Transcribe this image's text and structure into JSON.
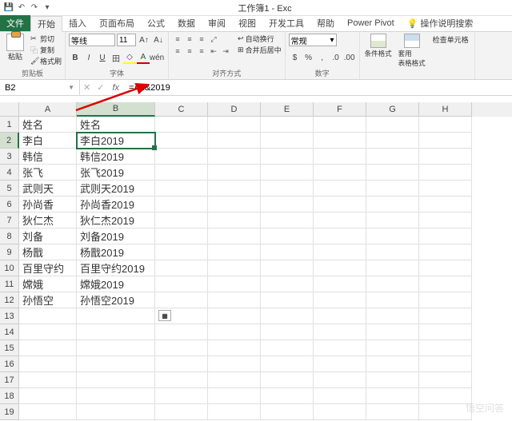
{
  "titlebar": {
    "title": "工作簿1 - Exc"
  },
  "tabs": {
    "file": "文件",
    "home": "开始",
    "insert": "插入",
    "layout": "页面布局",
    "formulas": "公式",
    "data": "数据",
    "review": "审阅",
    "view": "视图",
    "dev": "开发工具",
    "help": "帮助",
    "powerpivot": "Power Pivot",
    "tellme": "操作说明搜索"
  },
  "ribbon": {
    "clipboard": {
      "paste": "粘贴",
      "cut": "剪切",
      "copy": "复制",
      "format_painter": "格式刷",
      "label": "剪贴板"
    },
    "font": {
      "name": "等线",
      "size": "11",
      "label": "字体"
    },
    "alignment": {
      "wrap": "自动换行",
      "merge": "合并后居中",
      "label": "对齐方式"
    },
    "number": {
      "format": "常规",
      "label": "数字"
    },
    "styles": {
      "cond": "条件格式",
      "table": "套用\n表格格式",
      "cell_style": "检查单元格"
    }
  },
  "namebox": "B2",
  "formula": "=A2&2019",
  "columns": [
    "A",
    "B",
    "C",
    "D",
    "E",
    "F",
    "G",
    "H"
  ],
  "rows": [
    {
      "n": 1,
      "A": "姓名",
      "B": "姓名"
    },
    {
      "n": 2,
      "A": "李白",
      "B": "李白2019"
    },
    {
      "n": 3,
      "A": "韩信",
      "B": "韩信2019"
    },
    {
      "n": 4,
      "A": "张飞",
      "B": "张飞2019"
    },
    {
      "n": 5,
      "A": "武则天",
      "B": "武则天2019"
    },
    {
      "n": 6,
      "A": "孙尚香",
      "B": "孙尚香2019"
    },
    {
      "n": 7,
      "A": "狄仁杰",
      "B": "狄仁杰2019"
    },
    {
      "n": 8,
      "A": "刘备",
      "B": "刘备2019"
    },
    {
      "n": 9,
      "A": "杨戬",
      "B": "杨戬2019"
    },
    {
      "n": 10,
      "A": "百里守约",
      "B": "百里守约2019"
    },
    {
      "n": 11,
      "A": "嫦娥",
      "B": "嫦娥2019"
    },
    {
      "n": 12,
      "A": "孙悟空",
      "B": "孙悟空2019"
    },
    {
      "n": 13
    },
    {
      "n": 14
    },
    {
      "n": 15
    },
    {
      "n": 16
    },
    {
      "n": 17
    },
    {
      "n": 18
    },
    {
      "n": 19
    }
  ],
  "active_cell": "B2",
  "watermark": "悟空问答"
}
